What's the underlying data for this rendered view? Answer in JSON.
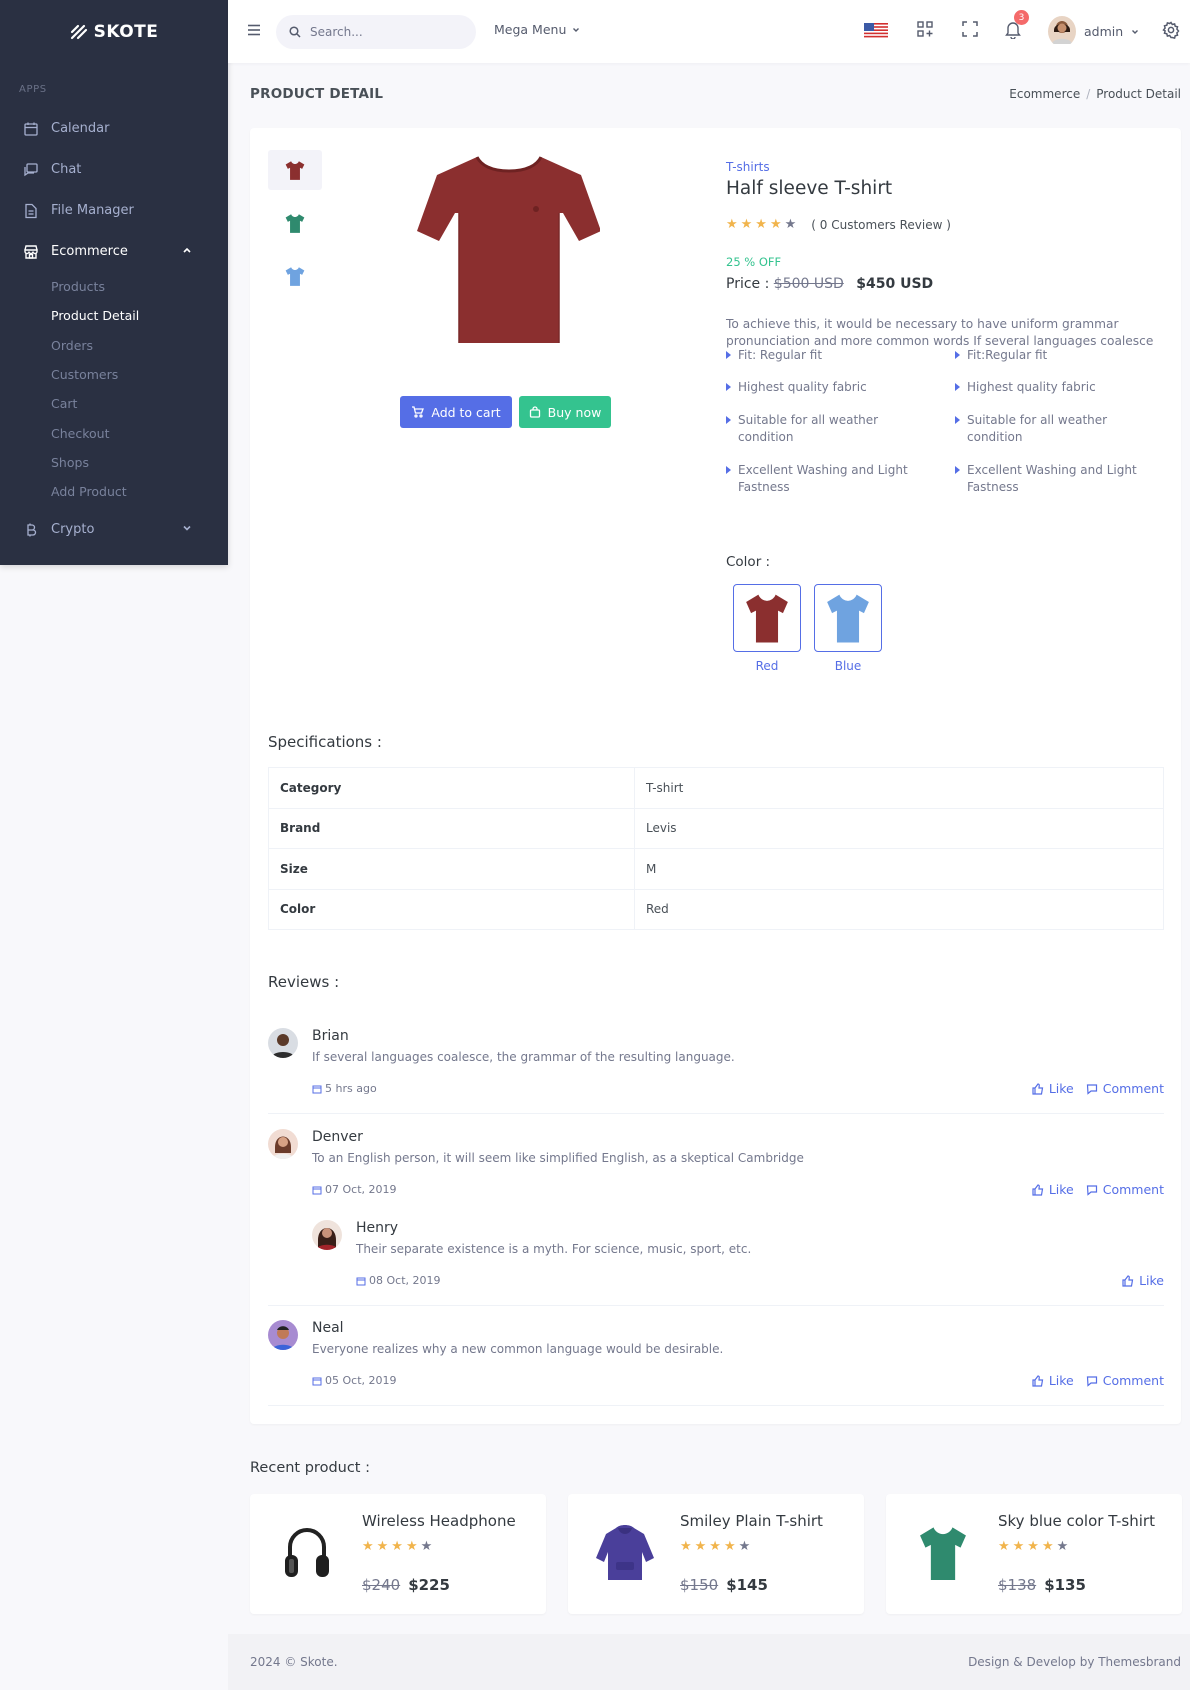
{
  "brand": {
    "name": "SKOTE"
  },
  "sidebar": {
    "section_title": "APPS",
    "items": [
      {
        "label": "Calendar",
        "icon": "calendar-icon"
      },
      {
        "label": "Chat",
        "icon": "chat-icon"
      },
      {
        "label": "File Manager",
        "icon": "file-icon"
      },
      {
        "label": "Ecommerce",
        "icon": "store-icon",
        "expanded": true
      },
      {
        "label": "Crypto",
        "icon": "bitcoin-icon"
      }
    ],
    "ecommerce_sub": [
      "Products",
      "Product Detail",
      "Orders",
      "Customers",
      "Cart",
      "Checkout",
      "Shops",
      "Add Product"
    ],
    "active_sub": "Product Detail"
  },
  "topbar": {
    "search_placeholder": "Search...",
    "mega_menu": "Mega Menu",
    "notifications_count": "3",
    "user": "admin"
  },
  "page": {
    "title": "PRODUCT DETAIL",
    "breadcrumb": [
      "Ecommerce",
      "Product Detail"
    ]
  },
  "product": {
    "category": "T-shirts",
    "name": "Half sleeve T-shirt",
    "rating": 4,
    "review_text": "( 0 Customers Review )",
    "discount": "25 % OFF",
    "price_label": "Price :",
    "old_price": "$500 USD",
    "price": "$450 USD",
    "description": "To achieve this, it would be necessary to have uniform grammar pronunciation and more common words If several languages coalesce",
    "features_left": [
      "Fit: Regular fit",
      "Highest quality fabric",
      "Suitable for all weather condition",
      "Excellent Washing and Light Fastness"
    ],
    "features_right": [
      "Fit:Regular fit",
      "Highest quality fabric",
      "Suitable for all weather condition",
      "Excellent Washing and Light Fastness"
    ],
    "add_to_cart": "Add to cart",
    "buy_now": "Buy now",
    "color_label": "Color :",
    "colors": [
      {
        "name": "Red",
        "hex": "#8b2f2f"
      },
      {
        "name": "Blue",
        "hex": "#6fa3e0"
      }
    ]
  },
  "specifications": {
    "title": "Specifications :",
    "rows": [
      {
        "key": "Category",
        "value": "T-shirt"
      },
      {
        "key": "Brand",
        "value": "Levis"
      },
      {
        "key": "Size",
        "value": "M"
      },
      {
        "key": "Color",
        "value": "Red"
      }
    ]
  },
  "reviews": {
    "title": "Reviews :",
    "like": "Like",
    "comment": "Comment",
    "items": [
      {
        "name": "Brian",
        "text": "If several languages coalesce, the grammar of the resulting language.",
        "date": "5 hrs ago"
      },
      {
        "name": "Denver",
        "text": "To an English person, it will seem like simplified English, as a skeptical Cambridge",
        "date": "07 Oct, 2019"
      },
      {
        "name": "Henry",
        "text": "Their separate existence is a myth. For science, music, sport, etc.",
        "date": "08 Oct, 2019"
      },
      {
        "name": "Neal",
        "text": "Everyone realizes why a new common language would be desirable.",
        "date": "05 Oct, 2019"
      }
    ]
  },
  "recent": {
    "title": "Recent product :",
    "items": [
      {
        "name": "Wireless Headphone",
        "old": "$240",
        "price": "$225",
        "rating": 4
      },
      {
        "name": "Smiley Plain T-shirt",
        "old": "$150",
        "price": "$145",
        "rating": 4
      },
      {
        "name": "Sky blue color T-shirt",
        "old": "$138",
        "price": "$135",
        "rating": 4
      }
    ]
  },
  "footer": {
    "left": "2024 © Skote.",
    "right": "Design & Develop by Themesbrand"
  },
  "colors": {
    "primary": "#556ee6",
    "success": "#34c38f",
    "sidebar": "#2a3042",
    "star": "#f1b44c",
    "danger": "#f46a6a"
  }
}
